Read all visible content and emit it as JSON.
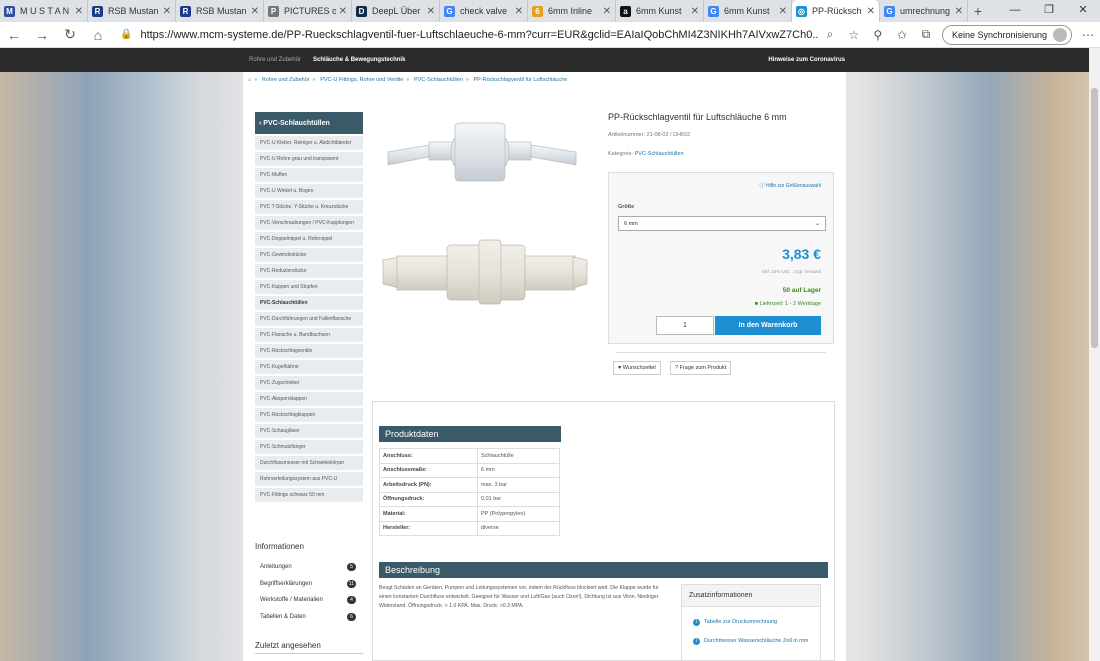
{
  "browser": {
    "tabs": [
      {
        "label": "M U S T A N",
        "fav": "M",
        "color": "#2c4da0"
      },
      {
        "label": "RSB Mustan",
        "fav": "R",
        "color": "#1a3d8a"
      },
      {
        "label": "RSB Mustan",
        "fav": "R",
        "color": "#1a3d8a"
      },
      {
        "label": "PICTURES of",
        "fav": "P",
        "color": "#777"
      },
      {
        "label": "DeepL Über",
        "fav": "D",
        "color": "#0f2b46"
      },
      {
        "label": "check valve",
        "fav": "G",
        "color": "#4285f4"
      },
      {
        "label": "6mm Inline",
        "fav": "6",
        "color": "#e4a11b"
      },
      {
        "label": "6mm Kunst",
        "fav": "a",
        "color": "#111"
      },
      {
        "label": "6mm Kunst",
        "fav": "G",
        "color": "#4285f4"
      },
      {
        "label": "PP-Rücksch",
        "fav": "◎",
        "color": "#1e8fd0",
        "active": true
      },
      {
        "label": "umrechnung",
        "fav": "G",
        "color": "#4285f4"
      }
    ],
    "url": "https://www.mcm-systeme.de/PP-Rueckschlagventil-fuer-Luftschlaeuche-6-mm?curr=EUR&gclid=EAIaIQobChMI4Z3NIKHh7AIVxwZ7Ch0...",
    "sync_label": "Keine Synchronisierung"
  },
  "site": {
    "nav_left": "Rohre und Zubehör",
    "nav_mid": "Schläuche & Bewegungstechnik",
    "nav_right": "Hinweise zum Coronavirus",
    "breadcrumb": [
      "Rohre und Zubehör",
      "PVC-U Fittings, Rohre und Ventile",
      "PVC-Schlauchtüllen",
      "PP-Rückschlagventil für Luftschläuche"
    ]
  },
  "sidebar": {
    "header": "PVC-Schlauchtüllen",
    "items": [
      "PVC-U Kleber, Reiniger u. Abdichtbänder",
      "PVC-U Rohre grau und transparent",
      "PVC-Muffen",
      "PVC-U Winkel u. Bogen",
      "PVC T-Stücke, Y-Stücke u. Kreuzstücke",
      "PVC-Verschraubungen / PVC-Kupplungen",
      "PVC-Doppelnippel u. Rohrnippel",
      "PVC-Gewindestücke",
      "PVC-Reduzierstücke",
      "PVC-Kappen und Stopfen",
      "PVC-Schlauchtüllen",
      "PVC-Durchführungen und Fallenflansche",
      "PVC-Flansche u. Bundbuchsen",
      "PVC-Rückschlagventile",
      "PVC-Kugelhähne",
      "PVC-Zugschieber",
      "PVC-Absperrklappen",
      "PVC-Rückschlagklappen",
      "PVC-Schaugläser",
      "PVC-Schmutzfänger",
      "Durchflussmesser mit Schwebekörper",
      "Rohrverteilungssystem aus PVC-U",
      "PVC-Fittings schwarz 50 mm"
    ],
    "info_title": "Informationen",
    "info_items": [
      {
        "label": "Anleitungen",
        "count": "5"
      },
      {
        "label": "Begriffserklärungen",
        "count": "11"
      },
      {
        "label": "Werkstoffe / Materialien",
        "count": "4"
      },
      {
        "label": "Tabellen & Daten",
        "count": "6"
      }
    ],
    "recent_title": "Zuletzt angesehen"
  },
  "product": {
    "title": "PP-Rückschlagventil für Luftschläuche 6 mm",
    "article": "Artikelnummer: 21-08-02 / DH502",
    "category_label": "Kategorie:",
    "category": "PVC-Schlauchtüllen",
    "size_help": "Hilfe zur Größenauswahl",
    "size_label": "Größe",
    "size_value": "6 mm",
    "price": "3,83 €",
    "vat": "inkl. 16% USt. , zzgl. Versand",
    "stock": "50 auf Lager",
    "delivery": "Lieferzeit: 1 - 2 Werktage",
    "qty": "1",
    "cart": "In den Warenkorb",
    "wish": "Wunschzettel",
    "ask": "Frage zum Produkt"
  },
  "specs": {
    "title": "Produktdaten",
    "rows": [
      {
        "k": "Anschluss:",
        "v": "Schlauchtülle"
      },
      {
        "k": "Anschlussmaße:",
        "v": "6 mm"
      },
      {
        "k": "Arbeitsdruck (PN):",
        "v": "max. 3 bar"
      },
      {
        "k": "Öffnungsdruck:",
        "v": "0,01 bar"
      },
      {
        "k": "Material:",
        "v": "PP (Polypropylen)"
      },
      {
        "k": "Hersteller:",
        "v": "diverse"
      }
    ]
  },
  "description": {
    "title": "Beschreibung",
    "text": "Beugt Schäden an Geräten, Pumpen und Leitungssystemen vor, indem der Rückfluss blockiert wird. Die Klappe wurde für einen konstanten Durchfluss entwickelt. Geeignet für Wasser und Luft/Gas (auch Ozon!). Dichtung ist aus Viton. Niedriger Widerstand. Öffnungsdruck: > 1.0 KPA. Max. Druck: >0.3 MPA.",
    "extra_title": "Zusatzinformationen",
    "extra_links": [
      "Tabelle zur Druckumrechnung",
      "Durchmesser Wasserschläuche Zoll in mm"
    ]
  }
}
